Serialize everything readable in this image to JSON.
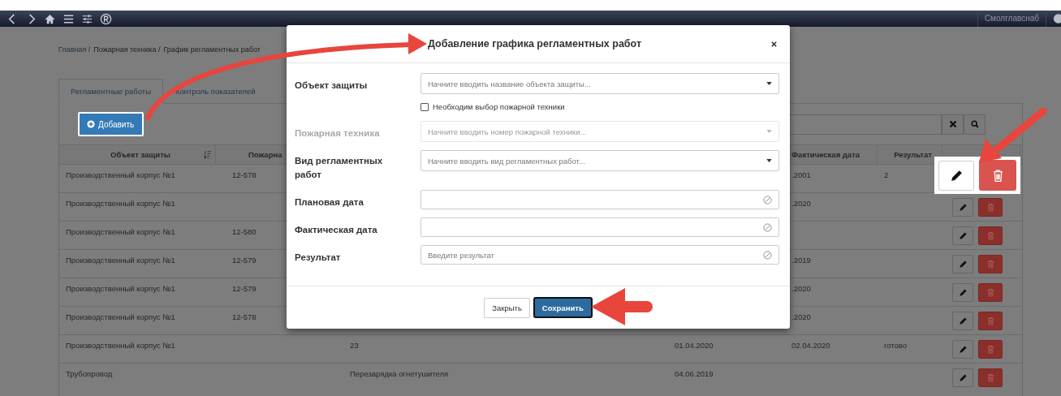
{
  "nav": {
    "org": "Смолглавснаб"
  },
  "breadcrumb": [
    "Главная /",
    "Пожарная техника /",
    "График регламентных работ"
  ],
  "tabs": [
    {
      "label": "Регламентные работы",
      "selected": true
    },
    {
      "label": "Контроль показателей",
      "selected": false
    }
  ],
  "add_button": "Добавить",
  "table": {
    "columns": {
      "object": "Объект защиты",
      "vehicle": "Пожарна",
      "actual_date": "Фактическая дата",
      "result": "Результат"
    },
    "rows": [
      {
        "object": "Производственный корпус №1",
        "vehicle": "12-578",
        "actual_date": ".2001",
        "result": "2",
        "highlighted": true
      },
      {
        "object": "Производственный корпус №1",
        "actual_date": ".2020",
        "highlighted": false
      },
      {
        "object": "Производственный корпус №1",
        "vehicle": "12-580",
        "highlighted": false
      },
      {
        "object": "Производственный корпус №1",
        "vehicle": "12-579",
        "actual_date": ".2019",
        "highlighted": false
      },
      {
        "object": "Производственный корпус №1",
        "vehicle": "12-579",
        "actual_date": ".2020",
        "highlighted": false
      },
      {
        "object": "Производственный корпус №1",
        "vehicle": "12-578",
        "actual_date": ".2020",
        "highlighted": false
      },
      {
        "object": "Производственный корпус №1",
        "work": "23",
        "planned_date": "01.04.2020",
        "actual_date": "02.04.2020",
        "result": "готово",
        "highlighted": false
      },
      {
        "object": "Трубопровод",
        "work": "Перезарядка огнетушителя",
        "planned_date": "04.06.2019",
        "highlighted": false
      }
    ]
  },
  "modal": {
    "title": "Добавление графика регламентных работ",
    "fields": [
      {
        "kind": "select",
        "label": "Объект защиты",
        "placeholder": "Начните вводить название объекта защиты...",
        "disabled": false
      },
      {
        "kind": "checkbox",
        "label": "Необходим выбор пожарной техники",
        "checked": false
      },
      {
        "kind": "select",
        "label": "Пожарная техника",
        "placeholder": "Начните вводить номер пожарной техники...",
        "disabled": true
      },
      {
        "kind": "select",
        "label": "Вид регламентных работ",
        "placeholder": "Начните вводить вид регламентных работ...",
        "disabled": false
      },
      {
        "kind": "input",
        "label": "Плановая дата"
      },
      {
        "kind": "input",
        "label": "Фактическая дата"
      },
      {
        "kind": "input",
        "label": "Результат",
        "placeholder": "Введите результат"
      }
    ],
    "close_button": "Закрыть",
    "save_button": "Сохранить"
  }
}
